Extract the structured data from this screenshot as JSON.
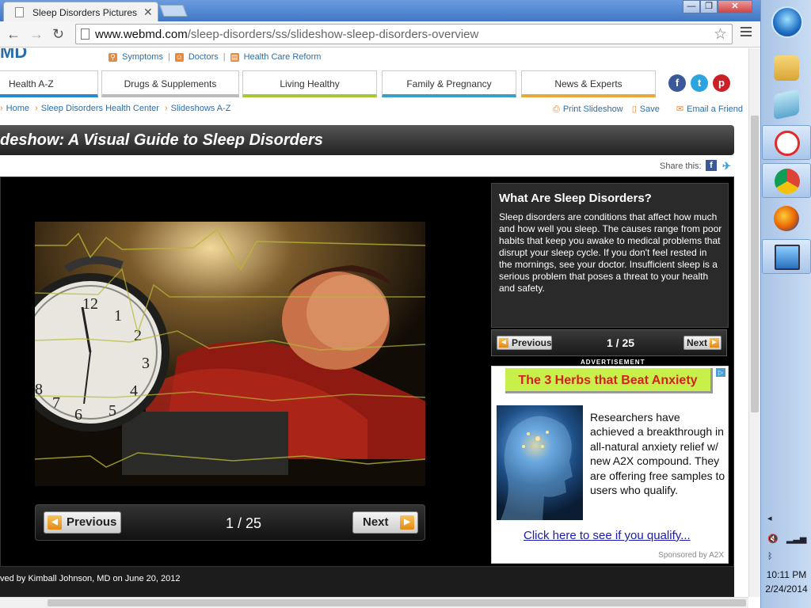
{
  "browser": {
    "tab_title": "Sleep Disorders Pictures Sl",
    "tab_close": "✕",
    "win_min": "—",
    "win_max": "❐",
    "win_close": "✕",
    "back": "←",
    "forward": "→",
    "reload": "↻",
    "url_host": "www.webmd.com",
    "url_path": "/sleep-disorders/ss/slideshow-sleep-disorders-overview",
    "star": "☆"
  },
  "site": {
    "logo": "MD",
    "top_links": [
      "Symptoms",
      "Doctors",
      "Health Care Reform"
    ],
    "nav_tabs": [
      "Health A-Z",
      "Drugs & Supplements",
      "Living Healthy",
      "Family & Pregnancy",
      "News & Experts"
    ],
    "social": [
      "f",
      "t",
      "p"
    ],
    "breadcrumbs": [
      "Home",
      "Sleep Disorders Health Center",
      "Slideshows A-Z"
    ],
    "actions": {
      "print": "Print Slideshow",
      "save": "Save",
      "email": "Email a Friend"
    }
  },
  "slideshow": {
    "title": "deshow: A Visual Guide to Sleep Disorders",
    "share_label": "Share this:",
    "slide_heading": "What Are Sleep Disorders?",
    "slide_text": "Sleep disorders are conditions that affect how much and how well you sleep. The causes range from poor habits that keep you awake to medical problems that disrupt your sleep cycle. If you don't feel rested in the mornings, see your doctor. Insufficient sleep is a serious problem that poses a threat to your health and safety.",
    "prev_label": "Previous",
    "next_label": "Next",
    "counter": "1 / 25",
    "reviewed": "ved by Kimball Johnson, MD on June 20, 2012"
  },
  "ad": {
    "label": "ADVERTISEMENT",
    "headline": "The 3 Herbs that Beat Anxiety",
    "body": "Researchers have achieved a breakthrough in all-natural anxiety relief w/ new A2X compound. They are offering free samples to users who qualify.",
    "cta": "Click here to see if you qualify...",
    "sponsor": "Sponsored by A2X"
  },
  "taskbar": {
    "time": "10:11 PM",
    "date": "2/24/2014"
  }
}
